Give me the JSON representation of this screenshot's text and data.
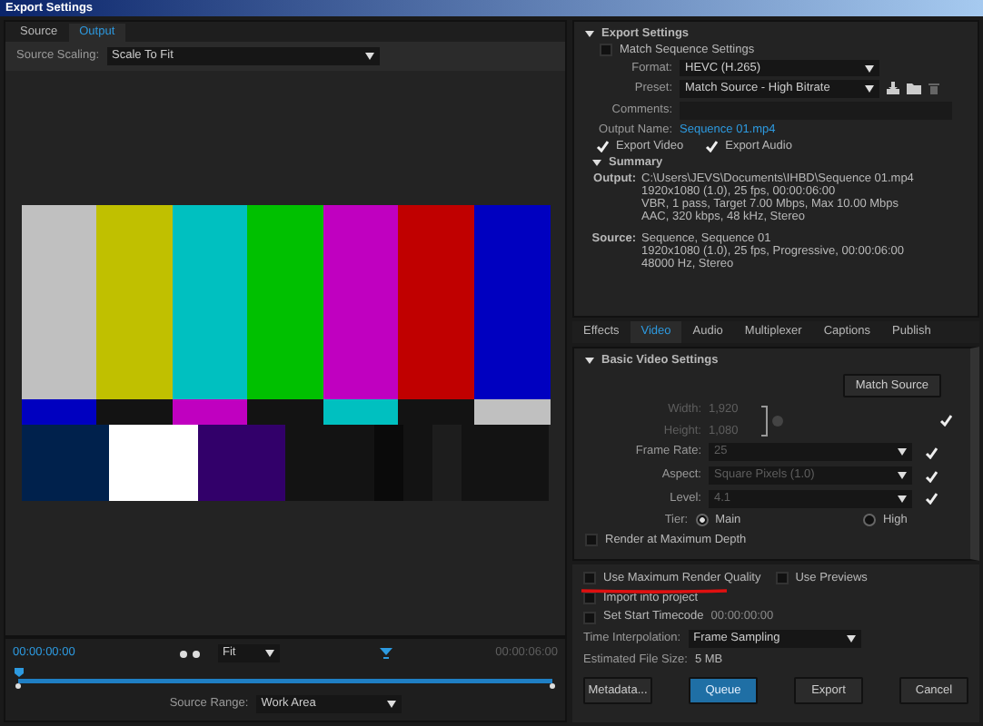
{
  "window": {
    "title": "Export Settings"
  },
  "source_panel": {
    "tabs": [
      {
        "label": "Source",
        "selected": false
      },
      {
        "label": "Output",
        "selected": true
      }
    ],
    "source_scaling": {
      "label": "Source Scaling:",
      "value": "Scale To Fit"
    },
    "timeline": {
      "start": "00:00:00:00",
      "zoom": "Fit",
      "end": "00:00:06:00"
    },
    "source_range": {
      "label": "Source Range:",
      "value": "Work Area"
    }
  },
  "export_settings": {
    "title": "Export Settings",
    "expanded": true,
    "match_sequence": {
      "label": "Match Sequence Settings",
      "checked": false
    },
    "format": {
      "label": "Format:",
      "value": "HEVC (H.265)"
    },
    "preset": {
      "label": "Preset:",
      "value": "Match Source - High Bitrate"
    },
    "comments": {
      "label": "Comments:"
    },
    "output_name": {
      "label": "Output Name:",
      "value": "Sequence 01.mp4"
    },
    "export_video": {
      "label": "Export Video",
      "checked": true
    },
    "export_audio": {
      "label": "Export Audio",
      "checked": true
    },
    "summary": {
      "title": "Summary",
      "expanded": true,
      "output_label": "Output:",
      "output_lines": [
        "C:\\Users\\JEVS\\Documents\\IHBD\\Sequence 01.mp4",
        "1920x1080 (1.0), 25 fps, 00:00:06:00",
        "VBR, 1 pass, Target 7.00 Mbps, Max 10.00 Mbps",
        "AAC, 320 kbps, 48 kHz, Stereo"
      ],
      "source_label": "Source:",
      "source_lines": [
        "Sequence, Sequence 01",
        "1920x1080 (1.0), 25 fps, Progressive, 00:00:06:00",
        "48000 Hz, Stereo"
      ]
    }
  },
  "tabs": [
    {
      "label": "Effects",
      "selected": false
    },
    {
      "label": "Video",
      "selected": true
    },
    {
      "label": "Audio",
      "selected": false
    },
    {
      "label": "Multiplexer",
      "selected": false
    },
    {
      "label": "Captions",
      "selected": false
    },
    {
      "label": "Publish",
      "selected": false
    }
  ],
  "video_settings": {
    "title": "Basic Video Settings",
    "expanded": true,
    "match_source": "Match Source",
    "width": {
      "label": "Width:",
      "value": "1,920",
      "disabled": true
    },
    "height": {
      "label": "Height:",
      "value": "1,080",
      "disabled": true
    },
    "size_checked": true,
    "fields": [
      {
        "label": "Frame Rate:",
        "value": "25",
        "checked": true
      },
      {
        "label": "Aspect:",
        "value": "Square Pixels (1.0)",
        "checked": true
      },
      {
        "label": "Level:",
        "value": "4.1",
        "checked": true
      }
    ],
    "tier": {
      "label": "Tier:",
      "options": [
        {
          "label": "Main",
          "selected": true
        },
        {
          "label": "High",
          "selected": false
        }
      ]
    },
    "render_max_depth": {
      "label": "Render at Maximum Depth",
      "checked": false
    }
  },
  "options": [
    {
      "label": "Use Maximum Render Quality",
      "checked": false,
      "underlined": true
    },
    {
      "label": "Use Previews",
      "checked": false,
      "underlined": false
    }
  ],
  "import_into_project": {
    "label": "Import into project",
    "checked": false
  },
  "start_timecode": {
    "label": "Set Start Timecode",
    "value": "00:00:00:00",
    "checked": false
  },
  "time_interpolation": {
    "label": "Time Interpolation:",
    "value": "Frame Sampling"
  },
  "file_size": {
    "label": "Estimated File Size:",
    "value": "5 MB"
  },
  "buttons": [
    {
      "label": "Metadata...",
      "kind": "plain"
    },
    {
      "label": "Queue",
      "kind": "primary"
    },
    {
      "label": "Export",
      "kind": "plain"
    },
    {
      "label": "Cancel",
      "kind": "plain"
    }
  ]
}
